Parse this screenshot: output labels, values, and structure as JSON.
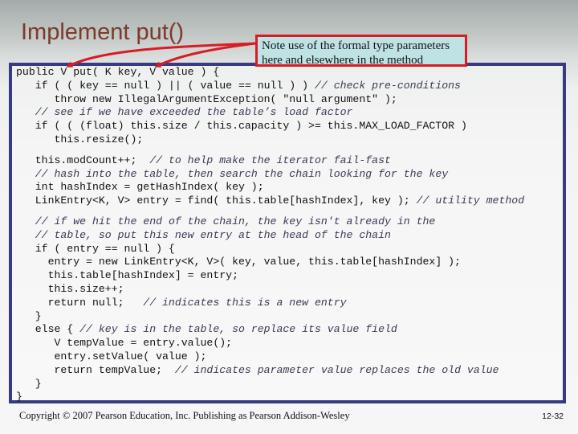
{
  "slide": {
    "title": "Implement put()",
    "callout": {
      "lines": [
        "Note use of the formal type parameters",
        "here and elsewhere in the method"
      ],
      "border_color": "#d81c24",
      "background_color": "#bfe2e4"
    },
    "accent_colors": {
      "title": "#7b3a2a",
      "code_box_border": "#383a82",
      "arrow": "#d81c24"
    }
  },
  "code": {
    "blocks": [
      [
        {
          "code": "public V put( K key, V value ) {",
          "comment": ""
        },
        {
          "code": "   if ( ( key == null ) || ( value == null ) ) ",
          "comment": "// check pre-conditions"
        },
        {
          "code": "      throw new IllegalArgumentException( \"null argument\" );",
          "comment": ""
        },
        {
          "code": "   ",
          "comment": "// see if we have exceeded the table’s load factor"
        },
        {
          "code": "   if ( ( (float) this.size / this.capacity ) >= this.MAX_LOAD_FACTOR )",
          "comment": ""
        },
        {
          "code": "      this.resize();",
          "comment": ""
        }
      ],
      [
        {
          "code": "   this.modCount++;  ",
          "comment": "// to help make the iterator fail-fast"
        },
        {
          "code": "   ",
          "comment": "// hash into the table, then search the chain looking for the key"
        },
        {
          "code": "   int hashIndex = getHashIndex( key );",
          "comment": ""
        },
        {
          "code": "   LinkEntry<K, V> entry = find( this.table[hashIndex], key ); ",
          "comment": "// utility method"
        }
      ],
      [
        {
          "code": "   ",
          "comment": "// if we hit the end of the chain, the key isn't already in the"
        },
        {
          "code": "   ",
          "comment": "// table, so put this new entry at the head of the chain"
        },
        {
          "code": "   if ( entry == null ) {",
          "comment": ""
        },
        {
          "code": "     entry = new LinkEntry<K, V>( key, value, this.table[hashIndex] );",
          "comment": ""
        },
        {
          "code": "     this.table[hashIndex] = entry;",
          "comment": ""
        },
        {
          "code": "     this.size++;",
          "comment": ""
        },
        {
          "code": "     return null;   ",
          "comment": "// indicates this is a new entry"
        },
        {
          "code": "   }",
          "comment": ""
        },
        {
          "code": "   else { ",
          "comment": "// key is in the table, so replace its value field"
        },
        {
          "code": "      V tempValue = entry.value();",
          "comment": ""
        },
        {
          "code": "      entry.setValue( value );",
          "comment": ""
        },
        {
          "code": "      return tempValue;  ",
          "comment": "// indicates parameter value replaces the old value"
        },
        {
          "code": "   }",
          "comment": ""
        },
        {
          "code": "}",
          "comment": ""
        }
      ]
    ]
  },
  "footer": {
    "copyright": "Copyright © 2007 Pearson Education, Inc. Publishing as Pearson Addison-Wesley",
    "page_number": "12-32"
  }
}
